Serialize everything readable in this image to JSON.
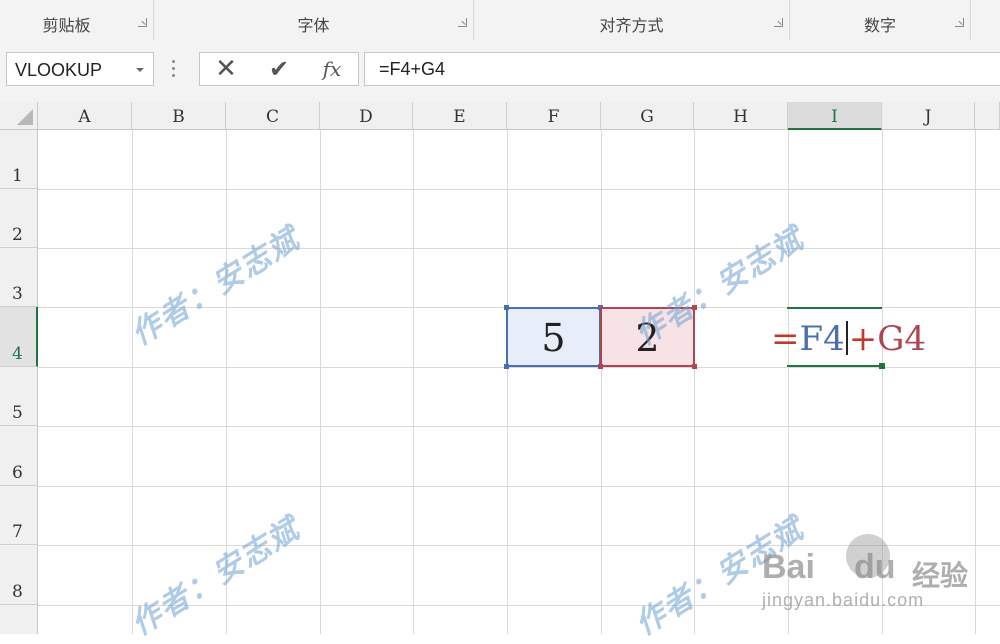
{
  "ribbon": {
    "groups": [
      {
        "label": "剪贴板"
      },
      {
        "label": "字体"
      },
      {
        "label": "对齐方式"
      },
      {
        "label": "数字"
      }
    ]
  },
  "formula_bar": {
    "name_box": "VLOOKUP",
    "cancel_icon": "✕",
    "enter_icon": "✔",
    "fx_label": "fx",
    "formula": "=F4+G4"
  },
  "sheet": {
    "columns": [
      "A",
      "B",
      "C",
      "D",
      "E",
      "F",
      "G",
      "H",
      "I",
      "J"
    ],
    "rows": [
      "1",
      "2",
      "3",
      "4",
      "5",
      "6",
      "7",
      "8"
    ],
    "selected_column": "I",
    "selected_row": "4",
    "cells": {
      "F4": "5",
      "G4": "2",
      "I4": {
        "eq": "=",
        "ref1": "F4",
        "plus": "+",
        "ref2": "G4"
      }
    },
    "colors": {
      "ref_blue": "#4a6fb0",
      "ref_red": "#b04552",
      "active_green": "#217346"
    }
  },
  "watermarks": {
    "text": "作者：安志斌",
    "baidu_logo": "Bai",
    "baidu_logo_du": "du",
    "baidu_jingyan": "经验",
    "baidu_url": "jingyan.baidu.com"
  }
}
